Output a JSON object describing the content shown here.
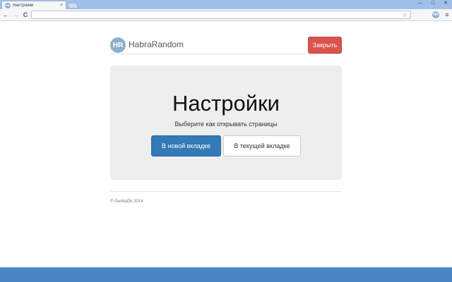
{
  "browser": {
    "tab": {
      "title": "Настройки",
      "favicon_text": "HR",
      "close_glyph": "×"
    },
    "window_controls": {
      "minimize": "—",
      "maximize": "□",
      "close": "✕"
    },
    "toolbar": {
      "back_glyph": "←",
      "forward_glyph": "→",
      "reload_glyph": "C",
      "address": "",
      "star_glyph": "☆",
      "extension_text": "HR",
      "menu_glyph": "≡"
    }
  },
  "page": {
    "header": {
      "logo_text": "HR",
      "brand": "HabraRandom",
      "close_button": "Закрыть"
    },
    "jumbotron": {
      "title": "Настройки",
      "subtitle": "Выберите как открывать страницы",
      "option_new_tab": "В новой вкладке",
      "option_current_tab": "В текущей вкладке",
      "selected_option": "option_new_tab"
    },
    "footer": {
      "copyright": "© GenkaOk 2014"
    }
  },
  "colors": {
    "close_button": "#d9534f",
    "primary_button": "#337ab7",
    "jumbotron_bg": "#eeeeee",
    "logo_bg": "#8fb0c9",
    "taskbar": "#4a86c5"
  }
}
